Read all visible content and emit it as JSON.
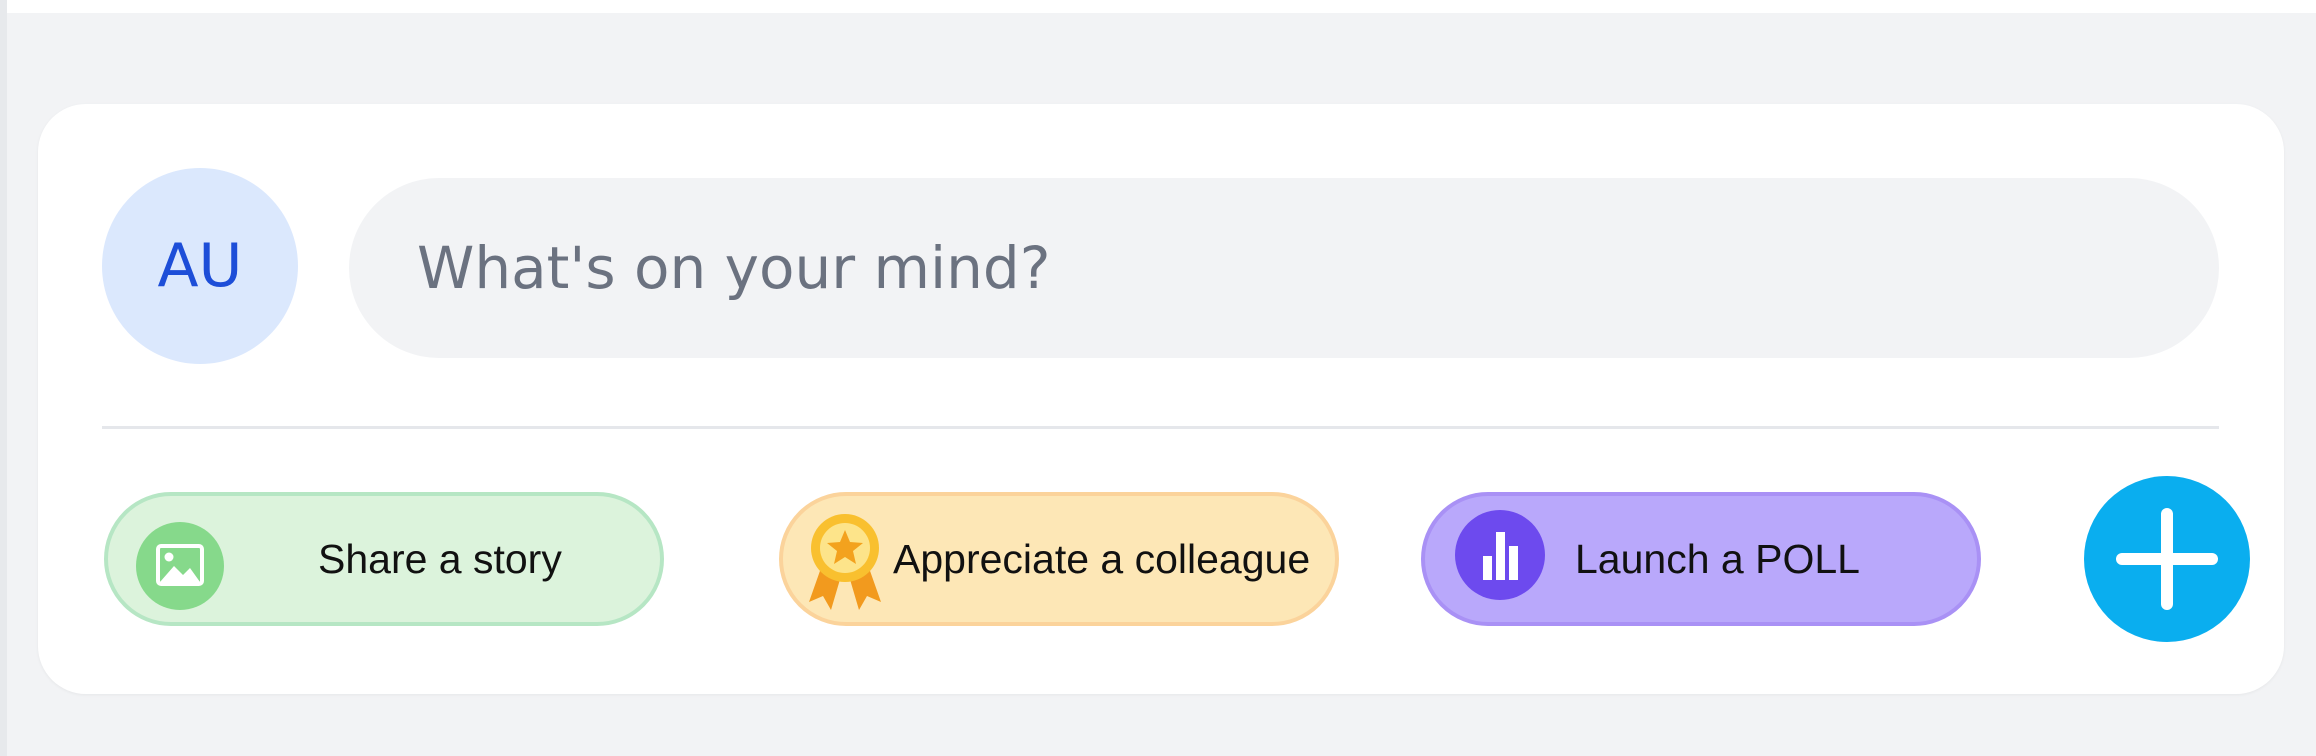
{
  "composer": {
    "avatar_initials": "AU",
    "placeholder": "What's on your mind?"
  },
  "actions": [
    {
      "label": "Share a story",
      "icon": "image-icon",
      "color": "#dcf3dc"
    },
    {
      "label": "Appreciate a colleague",
      "icon": "medal-icon",
      "color": "#fde7b6"
    },
    {
      "label": "Launch a POLL",
      "icon": "bar-chart-icon",
      "color": "#b9a8fb"
    }
  ],
  "fab": {
    "icon": "plus-icon",
    "color": "#0aaeef"
  },
  "colors": {
    "background": "#f2f3f5",
    "card": "#ffffff",
    "avatar_bg": "#dbe8fd",
    "avatar_text": "#1d4ed8"
  }
}
